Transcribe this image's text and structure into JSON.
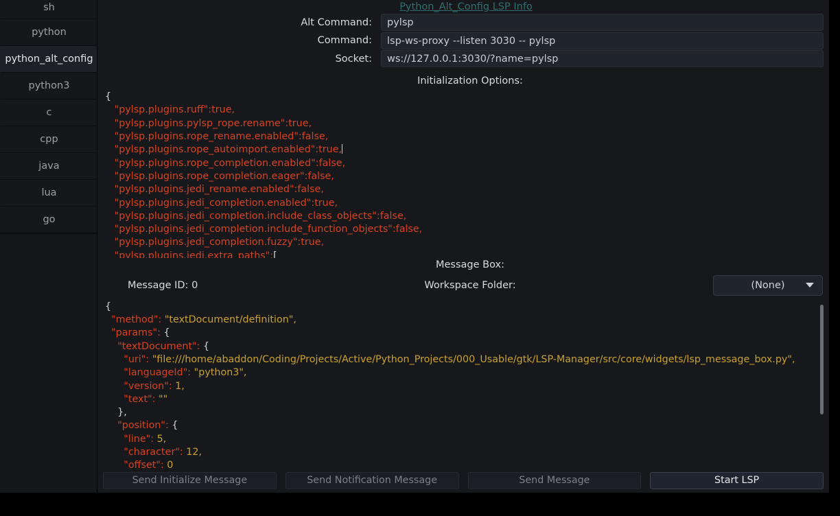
{
  "window": {
    "background": "#14161a"
  },
  "sidebar": {
    "items": [
      {
        "label": "sh",
        "selected": false
      },
      {
        "label": "python",
        "selected": false
      },
      {
        "label": "python_alt_config",
        "selected": true
      },
      {
        "label": "python3",
        "selected": false
      },
      {
        "label": "c",
        "selected": false
      },
      {
        "label": "cpp",
        "selected": false
      },
      {
        "label": "java",
        "selected": false
      },
      {
        "label": "lua",
        "selected": false
      },
      {
        "label": "go",
        "selected": false
      }
    ]
  },
  "header": {
    "info_link": "Python_Alt_Config LSP Info",
    "link_color": "#2f6f74"
  },
  "fields": {
    "alt_command": {
      "label": "Alt Command:",
      "value": "pylsp"
    },
    "command": {
      "label": "Command:",
      "value": "lsp-ws-proxy --listen 3030 -- pylsp"
    },
    "socket": {
      "label": "Socket:",
      "value": "ws://127.0.0.1:3030/?name=pylsp"
    }
  },
  "init_options": {
    "label": "Initialization Options:",
    "lines": [
      "{",
      "   \"pylsp.plugins.ruff\":true,",
      "   \"pylsp.plugins.pylsp_rope.rename\":true,",
      "   \"pylsp.plugins.rope_rename.enabled\":false,",
      "   \"pylsp.plugins.rope_autoimport.enabled\":true,",
      "   \"pylsp.plugins.rope_completion.enabled\":false,",
      "   \"pylsp.plugins.rope_completion.eager\":false,",
      "   \"pylsp.plugins.jedi_rename.enabled\":false,",
      "   \"pylsp.plugins.jedi_completion.enabled\":true,",
      "   \"pylsp.plugins.jedi_completion.include_class_objects\":false,",
      "   \"pylsp.plugins.jedi_completion.include_function_objects\":false,",
      "   \"pylsp.plugins.jedi_completion.fuzzy\":true,",
      "   \"pylsp.plugins.jedi.extra_paths\":["
    ]
  },
  "message_box": {
    "label": "Message Box:",
    "message_id": "Message ID: 0",
    "workspace_label": "Workspace Folder:",
    "workspace_value": "(None)",
    "json_lines": [
      "{",
      "  \"method\": \"textDocument/definition\",",
      "  \"params\": {",
      "    \"textDocument\": {",
      "      \"uri\": \"file:///home/abaddon/Coding/Projects/Active/Python_Projects/000_Usable/gtk/LSP-Manager/src/core/widgets/lsp_message_box.py\",",
      "      \"languageId\": \"python3\",",
      "      \"version\": 1,",
      "      \"text\": \"\"",
      "    },",
      "    \"position\": {",
      "      \"line\": 5,",
      "      \"character\": 12,",
      "      \"offset\": 0"
    ]
  },
  "buttons": {
    "send_initialize": "Send Initialize Message",
    "send_notification": "Send Notification Message",
    "send_message": "Send Message",
    "start_lsp": "Start LSP"
  }
}
